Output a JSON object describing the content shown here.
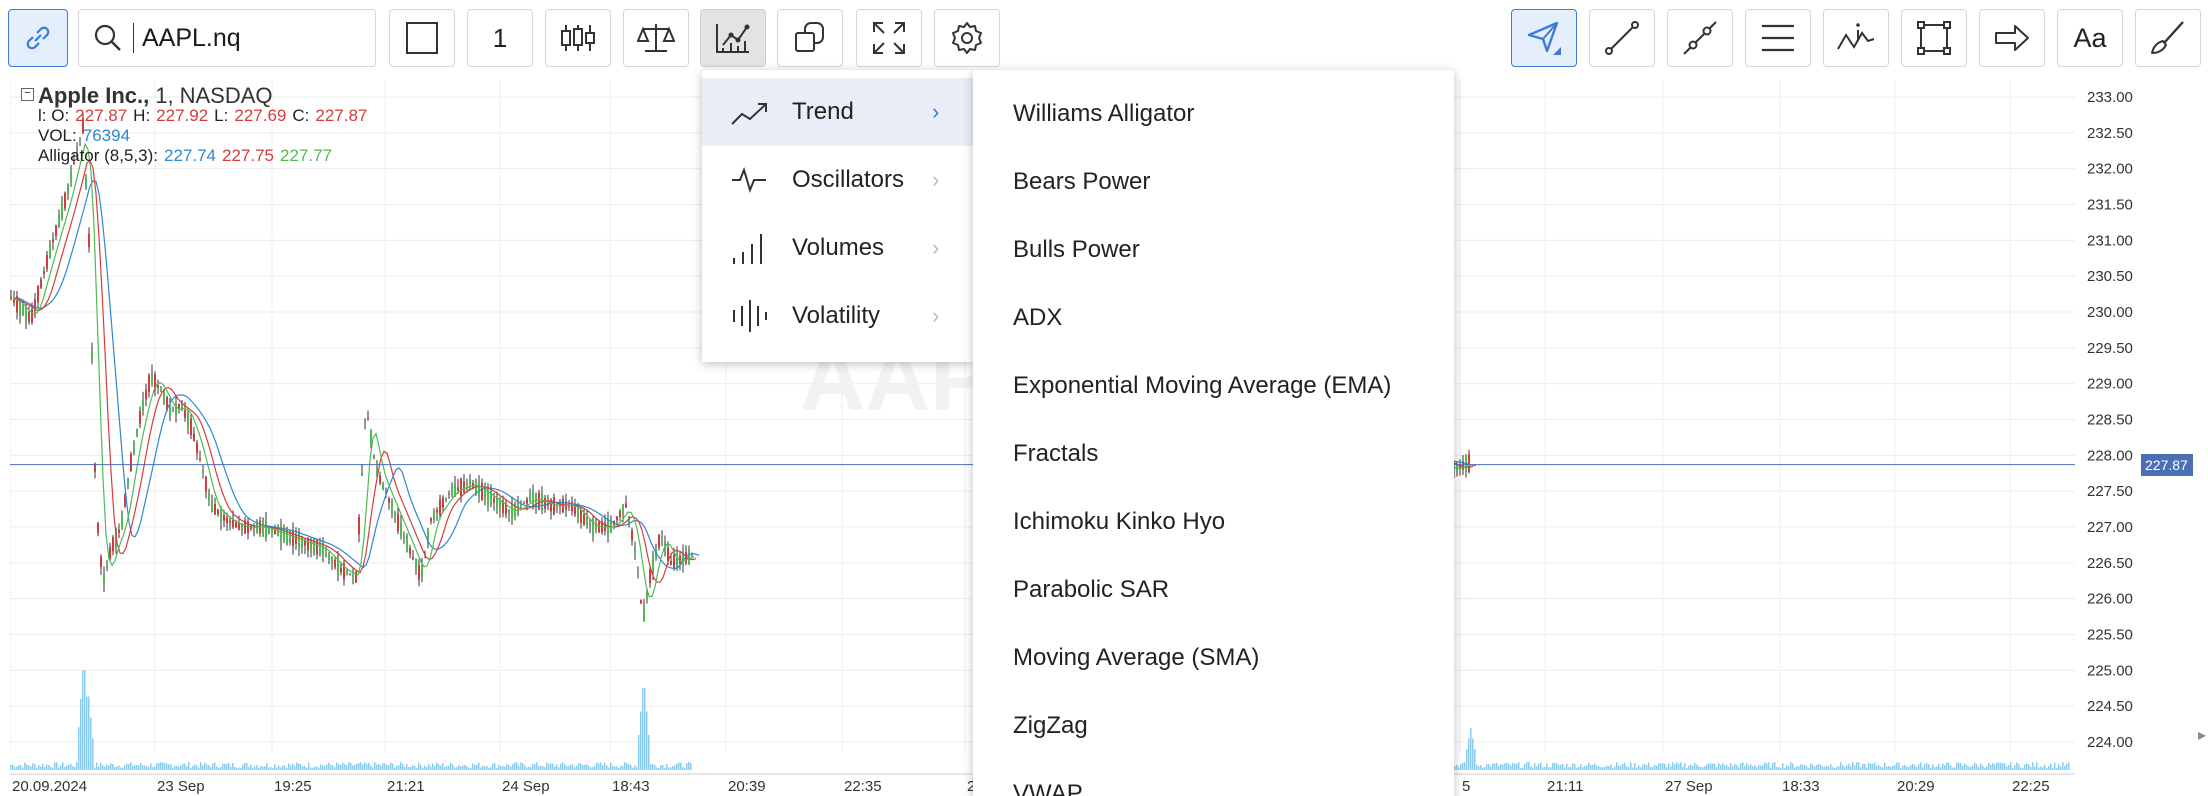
{
  "toolbar": {
    "search_value": "AAPL.nq",
    "interval": "1",
    "font_button": "Aa",
    "icons": [
      "link-icon",
      "search-icon",
      "square-icon",
      "candlestick-icon",
      "scales-icon",
      "indicators-icon",
      "shapes-icon",
      "fullscreen-icon",
      "gear-icon",
      "cursor-icon",
      "line-icon",
      "segment-icon",
      "parallel-lines-icon",
      "pattern-icon",
      "rectangle-icon",
      "arrow-icon",
      "brush-icon"
    ]
  },
  "legend": {
    "symbol": "Apple Inc.,",
    "interval": "1,",
    "exchange": "NASDAQ",
    "o_label": "l: O:",
    "o_value": "227.87",
    "h_label": "H:",
    "h_value": "227.92",
    "l_label": "L:",
    "l_value": "227.69",
    "c_label": "C:",
    "c_value": "227.87",
    "vol_label": "VOL:",
    "vol_value": "76394",
    "alligator_label": "Alligator (8,5,3):",
    "alligator_jaw": "227.74",
    "alligator_teeth": "227.75",
    "alligator_lips": "227.77"
  },
  "watermark": "AAPL",
  "last_price": "227.87",
  "colors": {
    "accent": "#3d7bd9",
    "up": "#52b957",
    "down": "#d43c3c",
    "volume": "#8ccbf0",
    "price_tag": "#4a6fb5"
  },
  "chart_data": {
    "type": "candlestick",
    "yticks": [
      "233.00",
      "232.50",
      "232.00",
      "231.50",
      "231.00",
      "230.50",
      "230.00",
      "229.50",
      "229.00",
      "228.50",
      "228.00",
      "227.50",
      "227.00",
      "226.50",
      "226.00",
      "225.50",
      "225.00",
      "224.50",
      "224.00"
    ],
    "ylim": [
      224.0,
      233.0
    ],
    "xticks": [
      "20.09.2024",
      "23 Sep",
      "19:25",
      "21:21",
      "24 Sep",
      "18:43",
      "20:39",
      "22:35",
      "2",
      "5",
      "21:11",
      "27 Sep",
      "18:33",
      "20:29",
      "22:25"
    ],
    "close_path": [
      [
        0,
        230.2
      ],
      [
        20,
        229.9
      ],
      [
        40,
        230.9
      ],
      [
        55,
        231.6
      ],
      [
        65,
        232.2
      ],
      [
        72,
        232.6
      ],
      [
        78,
        231.0
      ],
      [
        85,
        227.3
      ],
      [
        92,
        226.2
      ],
      [
        100,
        226.7
      ],
      [
        110,
        227.0
      ],
      [
        120,
        227.9
      ],
      [
        130,
        228.6
      ],
      [
        140,
        229.1
      ],
      [
        150,
        228.9
      ],
      [
        160,
        228.6
      ],
      [
        170,
        228.7
      ],
      [
        180,
        228.4
      ],
      [
        190,
        227.9
      ],
      [
        200,
        227.3
      ],
      [
        215,
        227.1
      ],
      [
        230,
        227.0
      ],
      [
        250,
        227.0
      ],
      [
        270,
        226.9
      ],
      [
        290,
        226.8
      ],
      [
        310,
        226.7
      ],
      [
        330,
        226.4
      ],
      [
        345,
        226.3
      ],
      [
        355,
        228.7
      ],
      [
        365,
        227.8
      ],
      [
        380,
        227.3
      ],
      [
        395,
        226.8
      ],
      [
        410,
        226.3
      ],
      [
        420,
        227.1
      ],
      [
        440,
        227.5
      ],
      [
        460,
        227.6
      ],
      [
        480,
        227.4
      ],
      [
        500,
        227.2
      ],
      [
        520,
        227.4
      ],
      [
        540,
        227.3
      ],
      [
        560,
        227.3
      ],
      [
        580,
        227.0
      ],
      [
        600,
        227.0
      ],
      [
        615,
        227.3
      ],
      [
        625,
        226.6
      ],
      [
        632,
        225.7
      ],
      [
        640,
        226.4
      ],
      [
        650,
        226.9
      ],
      [
        660,
        226.5
      ],
      [
        680,
        226.6
      ],
      [
        1030,
        227.5
      ],
      [
        1050,
        227.3
      ],
      [
        1070,
        227.1
      ],
      [
        1090,
        227.3
      ],
      [
        1110,
        227.5
      ],
      [
        1130,
        227.6
      ],
      [
        1150,
        227.7
      ],
      [
        1170,
        227.6
      ],
      [
        1180,
        227.1
      ],
      [
        1190,
        229.0
      ],
      [
        1200,
        229.1
      ],
      [
        1210,
        229.3
      ],
      [
        1220,
        229.2
      ],
      [
        1240,
        228.8
      ],
      [
        1255,
        228.1
      ],
      [
        1270,
        227.9
      ],
      [
        1285,
        227.7
      ],
      [
        1300,
        227.8
      ],
      [
        1320,
        228.0
      ],
      [
        1340,
        228.2
      ],
      [
        1360,
        227.9
      ],
      [
        1380,
        228.1
      ],
      [
        1400,
        227.8
      ],
      [
        1420,
        228.0
      ],
      [
        1440,
        227.8
      ],
      [
        1460,
        227.9
      ]
    ],
    "volume_spikes": [
      [
        73,
        0.95
      ],
      [
        77,
        0.7
      ],
      [
        633,
        0.78
      ],
      [
        1189,
        0.4
      ],
      [
        1460,
        0.35
      ]
    ]
  },
  "menu_categories": [
    {
      "label": "Trend",
      "icon": "trend-icon",
      "selected": true
    },
    {
      "label": "Oscillators",
      "icon": "oscillators-icon",
      "selected": false
    },
    {
      "label": "Volumes",
      "icon": "volumes-icon",
      "selected": false
    },
    {
      "label": "Volatility",
      "icon": "volatility-icon",
      "selected": false
    }
  ],
  "submenu_items": [
    "Williams Alligator",
    "Bears Power",
    "Bulls Power",
    "ADX",
    "Exponential Moving Average (EMA)",
    "Fractals",
    "Ichimoku Kinko Hyo",
    "Parabolic SAR",
    "Moving Average (SMA)",
    "ZigZag",
    "VWAP"
  ]
}
